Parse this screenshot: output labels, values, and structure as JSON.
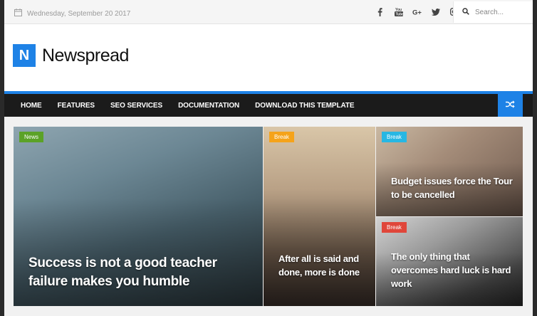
{
  "topbar": {
    "date": "Wednesday, September 20 2017",
    "social_icons": [
      "facebook-icon",
      "youtube-icon",
      "google-plus-icon",
      "twitter-icon",
      "instagram-icon"
    ],
    "search_placeholder": "Search..."
  },
  "header": {
    "logo_letter": "N",
    "site_name": "Newspread"
  },
  "nav": {
    "items": [
      {
        "label": "HOME"
      },
      {
        "label": "FEATURES"
      },
      {
        "label": "SEO SERVICES"
      },
      {
        "label": "DOCUMENTATION"
      },
      {
        "label": "DOWNLOAD THIS TEMPLATE"
      }
    ],
    "shuffle_icon": "shuffle-icon"
  },
  "featured": [
    {
      "badge": "News",
      "badge_color": "#5ba227",
      "title": "Success is not a good teacher failure makes you humble"
    },
    {
      "badge": "Break",
      "badge_color": "#f5a31a",
      "title": "After all is said and done, more is done"
    },
    {
      "badge": "Break",
      "badge_color": "#27b7e3",
      "title": "Budget issues force the Tour to be cancelled"
    },
    {
      "badge": "Break",
      "badge_color": "#e0463a",
      "title": "The only thing that overcomes hard luck is hard work"
    }
  ],
  "colors": {
    "accent": "#1e82e6",
    "nav_bg": "#1b1b1b"
  }
}
